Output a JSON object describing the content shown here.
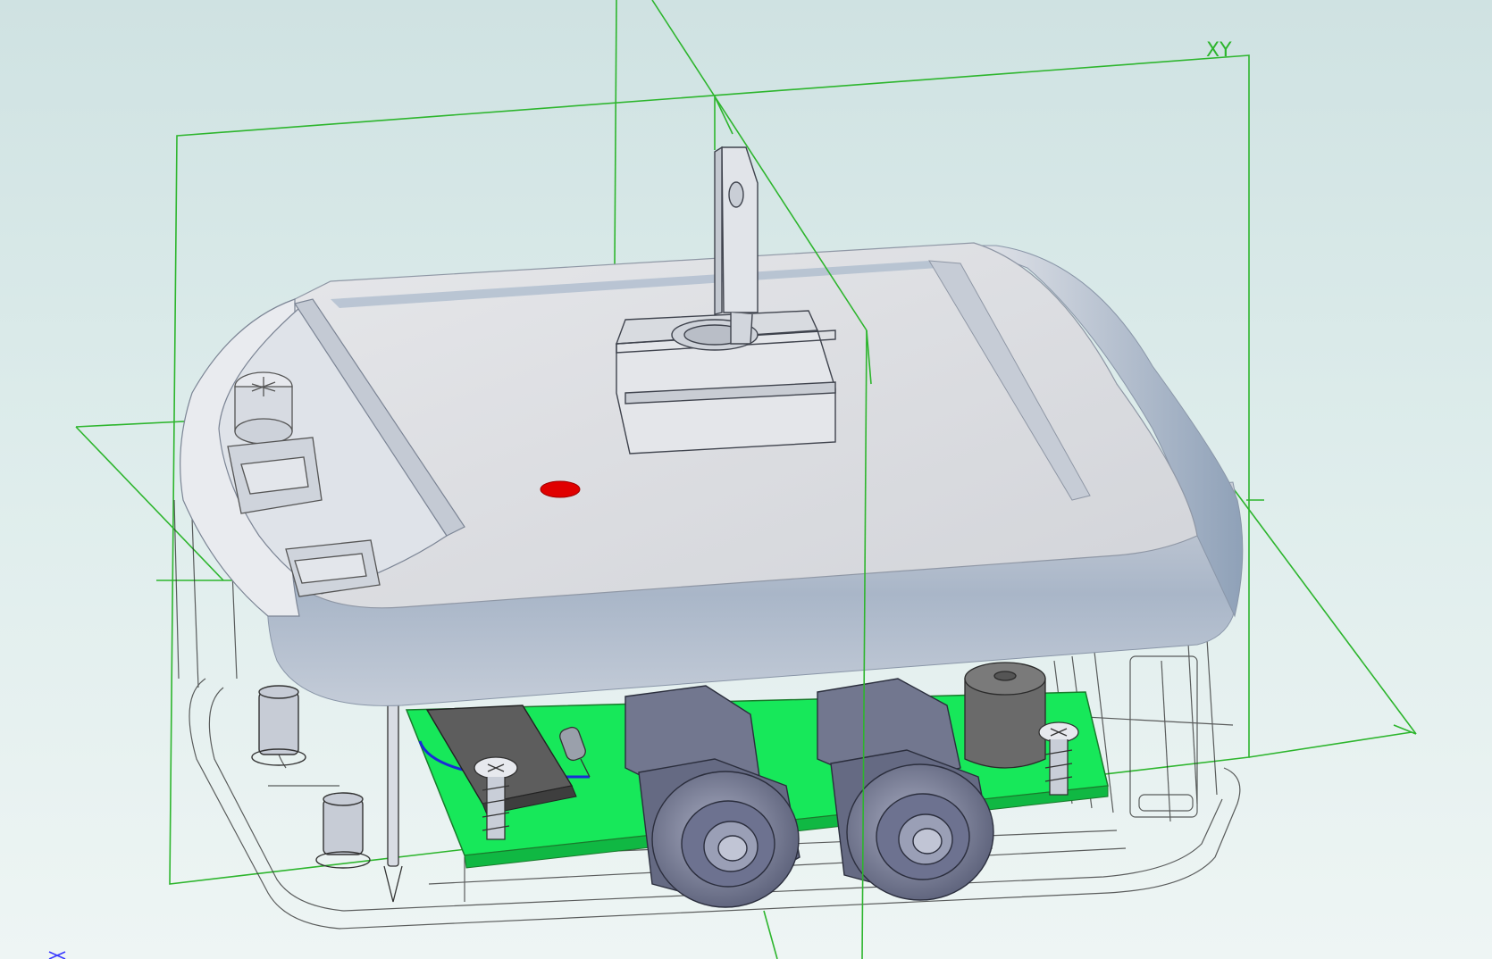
{
  "viewport": {
    "background_top": "#cfe2e2",
    "background_bottom": "#eef5f4"
  },
  "datum_planes": {
    "color": "#2db52d",
    "label_xy": "XY"
  },
  "triad": {
    "color": "#3b3bff"
  },
  "parts": {
    "housing_color": "#d9dde3",
    "lid_shadow": "#9fb0c6",
    "pcb_color": "#17e85a",
    "cable_gland_color": "#7a7f98",
    "indicator_led_color": "#e00000"
  }
}
